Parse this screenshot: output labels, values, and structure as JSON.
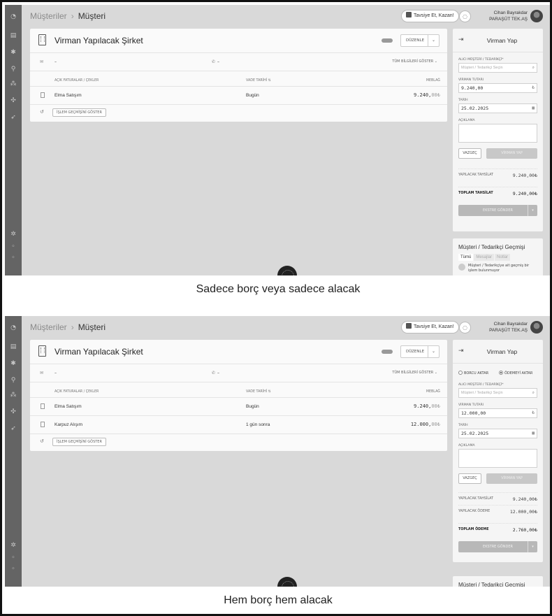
{
  "captions": [
    "Sadece borç veya sadece alacak",
    "Hem borç hem alacak"
  ],
  "colors": {
    "panel_bg": "#d9d9d9",
    "sidebar": "#646464",
    "card": "#fafafa"
  },
  "nav_icons": [
    "dashboard-icon",
    "sales-icon",
    "expenses-icon",
    "cash-icon",
    "customers-icon",
    "reports-icon",
    "rocket-icon"
  ],
  "topbar": {
    "breadcrumb_root": "Müşteriler",
    "breadcrumb_current": "Müşteri",
    "refer_label": "Tavsiye Et, Kazan!",
    "user_name": "Cihan Bayrakdar",
    "company": "PARAŞÜT TEK.AŞ"
  },
  "card": {
    "title": "Virman Yapılacak Şirket",
    "edit_label": "DÜZENLE",
    "email": "–",
    "phone": "–",
    "show_all": "TÜM BİLGİLERİ GÖSTER",
    "col_invoices": "AÇIK FATURALAR / ÇEKLER",
    "col_due": "VADE TARİHİ",
    "col_amount": "MEBLAĞ",
    "history_btn": "İŞLEM GEÇMİŞİNİ GÖSTER"
  },
  "rows1": [
    {
      "name": "Elma Satışım",
      "due": "Bugün",
      "amount": "9.240,",
      "dec": "00₺"
    }
  ],
  "rows2": [
    {
      "name": "Elma Satışım",
      "due": "Bugün",
      "amount": "9.240,",
      "dec": "00₺"
    },
    {
      "name": "Karpuz Alışım",
      "due": "1 gün sonra",
      "amount": "12.000,",
      "dec": "00₺"
    }
  ],
  "transfer": {
    "title": "Virman Yap",
    "radio_debt": "BORCU AKTAR",
    "radio_payment": "ÖDEMEYİ AKTAR",
    "label_recipient": "ALICI MÜŞTERİ / TEDARİKÇİ*",
    "placeholder_recipient": "Müşteri / Tedarikçi Seçin",
    "label_amount": "VİRMAN TUTARI",
    "amount1": "9.240,00",
    "amount2": "12.000,00",
    "label_date": "TARİH",
    "date": "25.02.2025",
    "label_desc": "AÇIKLAMA",
    "cancel": "VAZGEÇ",
    "submit": "VİRMAN YAP",
    "sum_collection_label": "YAPILACAK TAHSİLAT",
    "sum_collection": "9.240,00₺",
    "total_collection_label": "TOPLAM TAHSİLAT",
    "total_collection": "9.240,00₺",
    "sum_payment_label": "YAPILACAK ÖDEME",
    "sum_payment": "12.000,00₺",
    "total_payment_label": "TOPLAM ÖDEME",
    "total_payment": "2.760,00₺",
    "statement_btn": "EKSTRE GÖNDER"
  },
  "history": {
    "title": "Müşteri / Tedarikçi Geçmişi",
    "tabs": [
      "Tümü",
      "Mesajlar",
      "Notlar"
    ],
    "empty": "Müşteri / Tedarikçiye ait geçmiş bir işlem bulunmuyor"
  }
}
